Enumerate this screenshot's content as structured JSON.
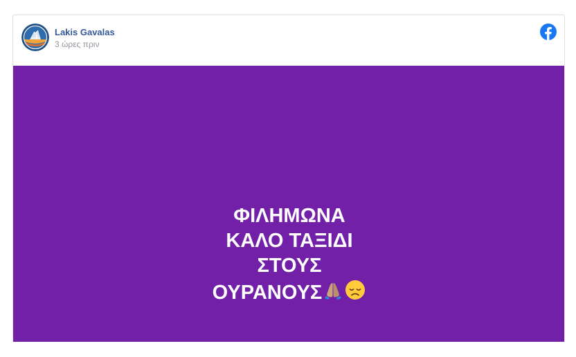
{
  "post": {
    "author_name": "Lakis Gavalas",
    "timestamp": "3 ώρες πριν",
    "avatar_icon": "profile-avatar-icon",
    "platform_icon": "facebook-icon",
    "background_color": "#7220a8",
    "text_color": "#ffffff",
    "status_lines": [
      "ΦΙΛΗΜΩΝΑ",
      "ΚΑΛΟ ΤΑΞΙΔΙ",
      "ΣΤΟΥΣ",
      "ΟΥΡΑΝΟΥΣ"
    ],
    "emojis": [
      "folded-hands-emoji",
      "disappointed-face-emoji"
    ]
  }
}
